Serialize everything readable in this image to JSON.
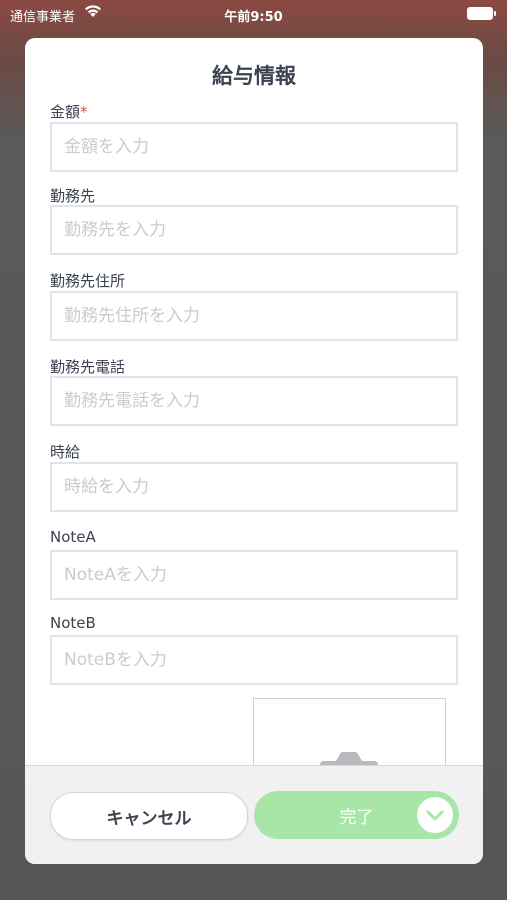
{
  "status_bar": {
    "carrier": "通信事業者",
    "time": "午前9:50",
    "wifi_icon": "wifi-icon",
    "battery_icon": "battery-icon"
  },
  "modal": {
    "title": "給与情報",
    "fields": [
      {
        "label": "金額",
        "required_mark": "*",
        "placeholder": "金額を入力",
        "value": ""
      },
      {
        "label": "勤務先",
        "placeholder": "勤務先を入力",
        "value": ""
      },
      {
        "label": "勤務先住所",
        "placeholder": "勤務先住所を入力",
        "value": ""
      },
      {
        "label": "勤務先電話",
        "placeholder": "勤務先電話を入力",
        "value": ""
      },
      {
        "label": "時給",
        "placeholder": "時給を入力",
        "value": ""
      },
      {
        "label": "NoteA",
        "placeholder": "NoteAを入力",
        "value": ""
      },
      {
        "label": "NoteB",
        "placeholder": "NoteBを入力",
        "value": ""
      }
    ],
    "photo_icon": "camera-icon"
  },
  "footer": {
    "cancel_label": "キャンセル",
    "done_label": "完了",
    "done_icon": "chevron-down-icon"
  },
  "colors": {
    "done_button": "#a8e6a8",
    "required": "#e34b4b",
    "text": "#3b4250"
  }
}
